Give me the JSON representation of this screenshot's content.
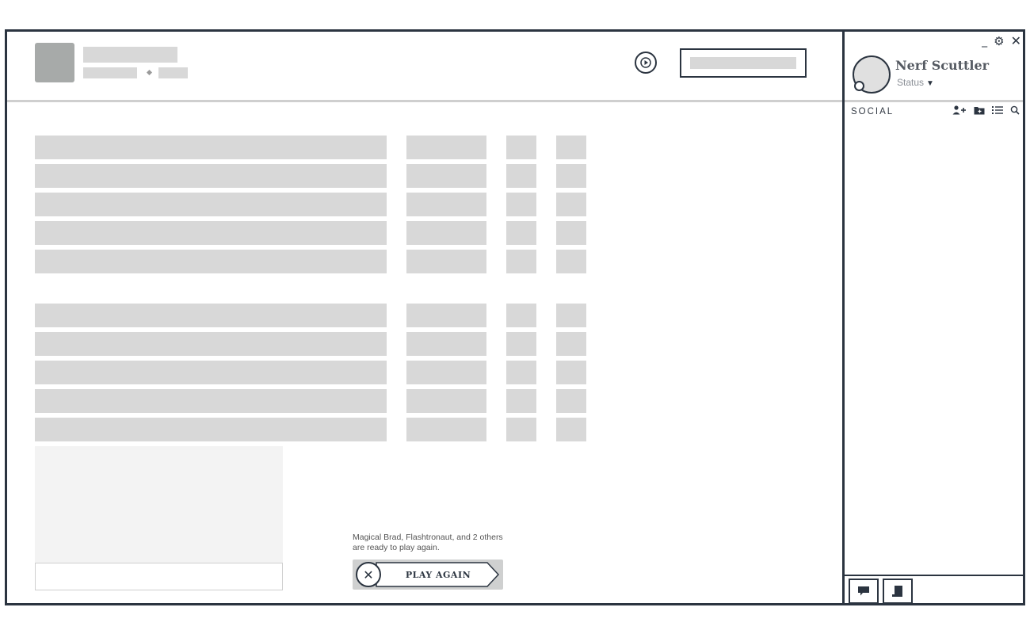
{
  "header": {
    "replay_icon": "play-circle-icon"
  },
  "lobby": {
    "ready_message": "Magical Brad, Flashtronaut, and 2 others are ready to play again.",
    "play_again_label": "PLAY AGAIN",
    "decline_icon": "close-icon",
    "decline_glyph": "✕"
  },
  "social": {
    "username": "Nerf Scuttler",
    "status_label": "Status",
    "status_caret": "▼",
    "section_label": "SOCIAL",
    "tools": [
      {
        "icon": "add-friend-icon",
        "glyph": "👤+"
      },
      {
        "icon": "add-folder-icon",
        "glyph": "🗀"
      },
      {
        "icon": "list-icon",
        "glyph": "☰"
      },
      {
        "icon": "search-icon",
        "glyph": "⌕"
      }
    ],
    "window_controls": {
      "minimize": "_",
      "settings": "⚙",
      "close": "✕"
    },
    "bottom_buttons": [
      {
        "icon": "chat-icon"
      },
      {
        "icon": "mission-log-icon"
      }
    ]
  },
  "colors": {
    "frame": "#2b3440",
    "placeholder": "#d8d8d8",
    "avatar": "#a7aaa9"
  }
}
